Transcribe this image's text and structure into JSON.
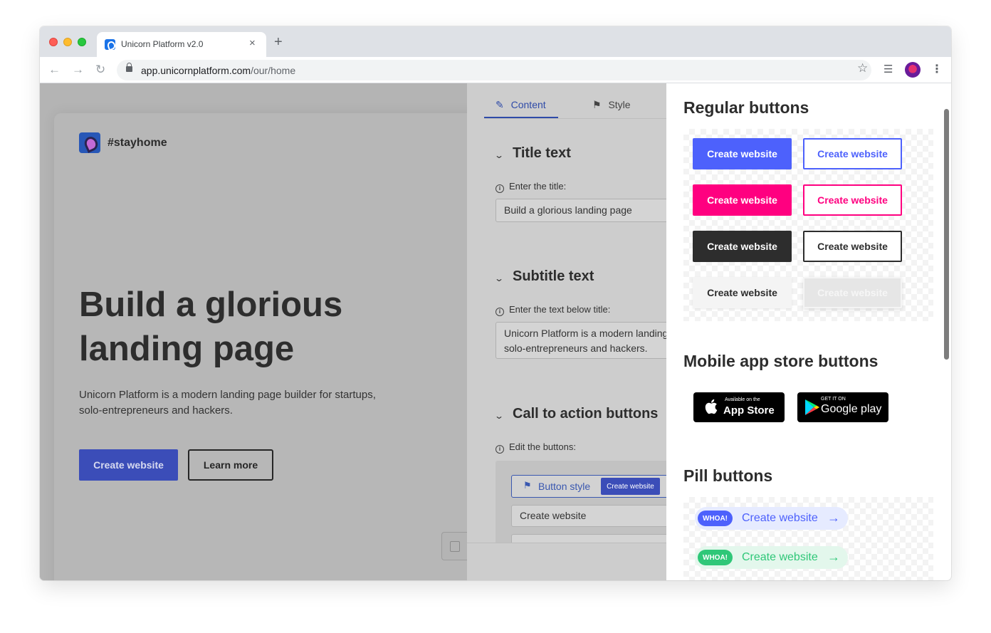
{
  "browser": {
    "tab_title": "Unicorn Platform v2.0",
    "tab_close": "×",
    "new_tab": "+",
    "url_host": "app.unicornplatform.com",
    "url_path": "/our/home",
    "icons": [
      "back-arrow-icon",
      "forward-arrow-icon",
      "reload-icon",
      "lock-icon",
      "star-icon",
      "media-control-icon",
      "profile-avatar",
      "kebab-menu-icon"
    ]
  },
  "preview": {
    "logo_text": "#stayhome",
    "hero_title": "Build a glorious landing page",
    "hero_subtitle": "Unicorn Platform is a modern landing page builder for startups, solo-entrepreneurs and hackers.",
    "primary_button": "Create website",
    "secondary_button": "Learn more"
  },
  "editor": {
    "tabs": [
      {
        "label": "Content",
        "icon": "pencil-icon",
        "active": true
      },
      {
        "label": "Style",
        "icon": "paint-bucket-icon",
        "active": false
      }
    ],
    "sections": [
      {
        "title": "Title text",
        "hint": "Enter the title:",
        "value": "Build a glorious landing page"
      },
      {
        "title": "Subtitle text",
        "hint": "Enter the text below title:",
        "value_line1": "Unicorn Platform is a modern landing",
        "value_line2": "solo-entrepreneurs and hackers."
      },
      {
        "title": "Call to action buttons",
        "hint": "Edit the buttons:"
      }
    ],
    "button_style_label": "Button style",
    "button_style_preview": "Create website",
    "button_text_value": "Create website"
  },
  "library": {
    "regular_heading": "Regular buttons",
    "regular_buttons": [
      {
        "label": "Create website",
        "style": "solid",
        "color": "#4d61fc"
      },
      {
        "label": "Create website",
        "style": "outline",
        "color": "#4d61fc"
      },
      {
        "label": "Create website",
        "style": "solid",
        "color": "#ff0080"
      },
      {
        "label": "Create website",
        "style": "outline",
        "color": "#ff0080"
      },
      {
        "label": "Create website",
        "style": "solid",
        "color": "#2d2d2d"
      },
      {
        "label": "Create website",
        "style": "outline",
        "color": "#2d2d2d"
      },
      {
        "label": "Create website",
        "style": "solid-light",
        "color": "#f4f4f4"
      },
      {
        "label": "Create website",
        "style": "ghost-light",
        "color": "#e8e8e8"
      }
    ],
    "mobile_heading": "Mobile app store buttons",
    "app_store": {
      "small": "Available on the",
      "big": "App Store"
    },
    "google_play": {
      "small": "GET IT ON",
      "big": "Google play"
    },
    "pill_heading": "Pill buttons",
    "pills": [
      {
        "badge": "WHOA!",
        "label": "Create website",
        "color": "#4d61fc",
        "bg": "#e6ebff"
      },
      {
        "badge": "WHOA!",
        "label": "Create website",
        "color": "#2fc778",
        "bg": "#e3f7ec"
      }
    ]
  }
}
